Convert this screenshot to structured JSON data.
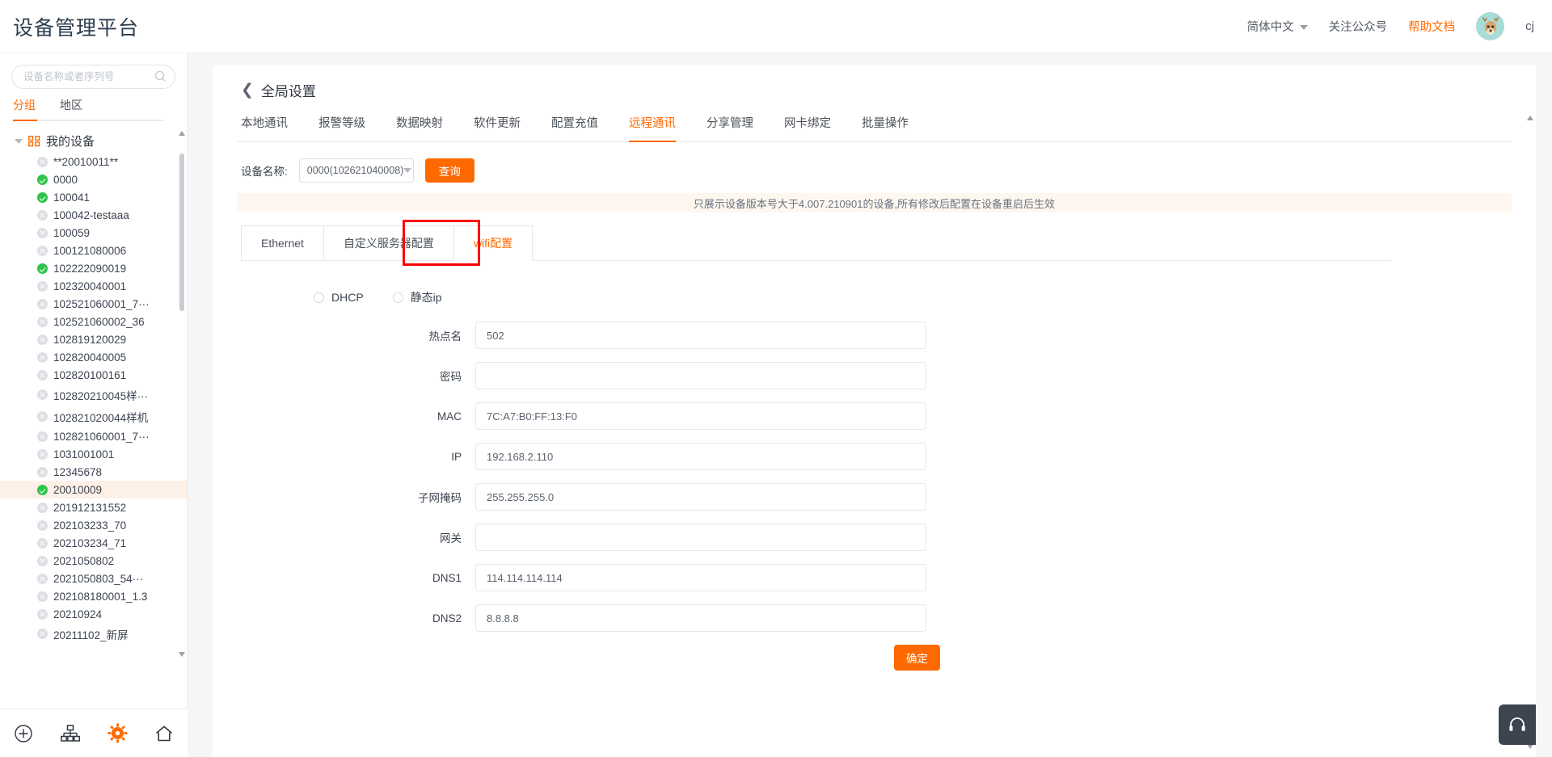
{
  "header": {
    "brand": "设备管理平台",
    "lang": "简体中文",
    "follow": "关注公众号",
    "help": "帮助文档",
    "username": "cj",
    "accent": "#ff6a00"
  },
  "sidebar": {
    "search_placeholder": "设备名称或者序列号",
    "tabs": [
      {
        "label": "分组",
        "active": true
      },
      {
        "label": "地区",
        "active": false
      }
    ],
    "root": {
      "label": "我的设备"
    },
    "nodes": [
      {
        "label": "**20010011**",
        "online": false,
        "selected": false
      },
      {
        "label": "0000",
        "online": true,
        "selected": false
      },
      {
        "label": "100041",
        "online": true,
        "selected": false
      },
      {
        "label": "100042-testaaa",
        "online": false,
        "selected": false
      },
      {
        "label": "100059",
        "online": false,
        "selected": false
      },
      {
        "label": "100121080006",
        "online": false,
        "selected": false
      },
      {
        "label": "102222090019",
        "online": true,
        "selected": false
      },
      {
        "label": "102320040001",
        "online": false,
        "selected": false
      },
      {
        "label": "102521060001_7···",
        "online": false,
        "selected": false
      },
      {
        "label": "102521060002_36",
        "online": false,
        "selected": false
      },
      {
        "label": "102819120029",
        "online": false,
        "selected": false
      },
      {
        "label": "102820040005",
        "online": false,
        "selected": false
      },
      {
        "label": "102820100161",
        "online": false,
        "selected": false
      },
      {
        "label": "102820210045样···",
        "online": false,
        "selected": false
      },
      {
        "label": "102821020044样机",
        "online": false,
        "selected": false
      },
      {
        "label": "102821060001_7···",
        "online": false,
        "selected": false
      },
      {
        "label": "1031001001",
        "online": false,
        "selected": false
      },
      {
        "label": "12345678",
        "online": false,
        "selected": false
      },
      {
        "label": "20010009",
        "online": true,
        "selected": true
      },
      {
        "label": "201912131552",
        "online": false,
        "selected": false
      },
      {
        "label": "202103233_70",
        "online": false,
        "selected": false
      },
      {
        "label": "202103234_71",
        "online": false,
        "selected": false
      },
      {
        "label": "2021050802",
        "online": false,
        "selected": false
      },
      {
        "label": "2021050803_54···",
        "online": false,
        "selected": false
      },
      {
        "label": "202108180001_1.3",
        "online": false,
        "selected": false
      },
      {
        "label": "20210924",
        "online": false,
        "selected": false
      },
      {
        "label": "20211102_新屏",
        "online": false,
        "selected": false
      }
    ],
    "footer": [
      {
        "icon": "plus-circle-icon",
        "active": false
      },
      {
        "icon": "org-tree-icon",
        "active": false
      },
      {
        "icon": "gear-icon",
        "active": true
      },
      {
        "icon": "home-icon",
        "active": false
      }
    ]
  },
  "main": {
    "back_icon": "chevron-left-icon",
    "title": "全局设置",
    "tabs": [
      {
        "label": "本地通讯",
        "active": false
      },
      {
        "label": "报警等级",
        "active": false
      },
      {
        "label": "数据映射",
        "active": false
      },
      {
        "label": "软件更新",
        "active": false
      },
      {
        "label": "配置充值",
        "active": false
      },
      {
        "label": "远程通讯",
        "active": true
      },
      {
        "label": "分享管理",
        "active": false
      },
      {
        "label": "网卡绑定",
        "active": false
      },
      {
        "label": "批量操作",
        "active": false
      }
    ],
    "filter": {
      "label": "设备名称:",
      "device_value": "0000(102621040008)",
      "query_button": "查询"
    },
    "notice": "只展示设备版本号大于4.007.210901的设备,所有修改后配置在设备重启后生效",
    "subtabs": [
      {
        "label": "Ethernet",
        "active": false
      },
      {
        "label": "自定义服务器配置",
        "active": false
      },
      {
        "label": "wifi配置",
        "active": true,
        "highlighted": true
      }
    ],
    "ip_mode": [
      {
        "label": "DHCP",
        "checked": false
      },
      {
        "label": "静态ip",
        "checked": false
      }
    ],
    "fields": [
      {
        "label": "热点名",
        "value": "502",
        "placeholder": ""
      },
      {
        "label": "密码",
        "value": "",
        "placeholder": ""
      },
      {
        "label": "MAC",
        "value": "7C:A7:B0:FF:13:F0",
        "placeholder": ""
      },
      {
        "label": "IP",
        "value": "192.168.2.110",
        "placeholder": ""
      },
      {
        "label": "子网掩码",
        "value": "255.255.255.0",
        "placeholder": ""
      },
      {
        "label": "网关",
        "value": "",
        "placeholder": ""
      },
      {
        "label": "DNS1",
        "value": "114.114.114.114",
        "placeholder": ""
      },
      {
        "label": "DNS2",
        "value": "8.8.8.8",
        "placeholder": ""
      }
    ],
    "confirm_button": "确定"
  }
}
